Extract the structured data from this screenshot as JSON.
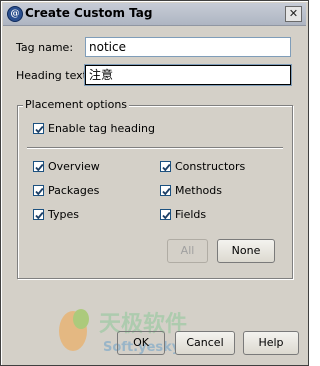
{
  "window": {
    "title": "Create Custom Tag",
    "close_glyph": "✕"
  },
  "form": {
    "tag_name_label": "Tag name:",
    "tag_name_value": "notice",
    "heading_text_label": "Heading text:",
    "heading_text_value": "注意"
  },
  "placement": {
    "legend": "Placement options",
    "enable_heading": {
      "label": "Enable tag heading",
      "checked": true
    },
    "options": [
      {
        "label": "Overview",
        "checked": true
      },
      {
        "label": "Constructors",
        "checked": true
      },
      {
        "label": "Packages",
        "checked": true
      },
      {
        "label": "Methods",
        "checked": true
      },
      {
        "label": "Types",
        "checked": true
      },
      {
        "label": "Fields",
        "checked": true
      }
    ],
    "all_button": "All",
    "none_button": "None"
  },
  "footer": {
    "ok_button": "OK",
    "cancel_button": "Cancel",
    "help_button": "Help"
  },
  "watermark": {
    "text": "天极软件",
    "subtext": "Soft.yesky.com"
  },
  "colors": {
    "checkmark": "#1c3f66",
    "title_bar": "#aeb5c2"
  }
}
